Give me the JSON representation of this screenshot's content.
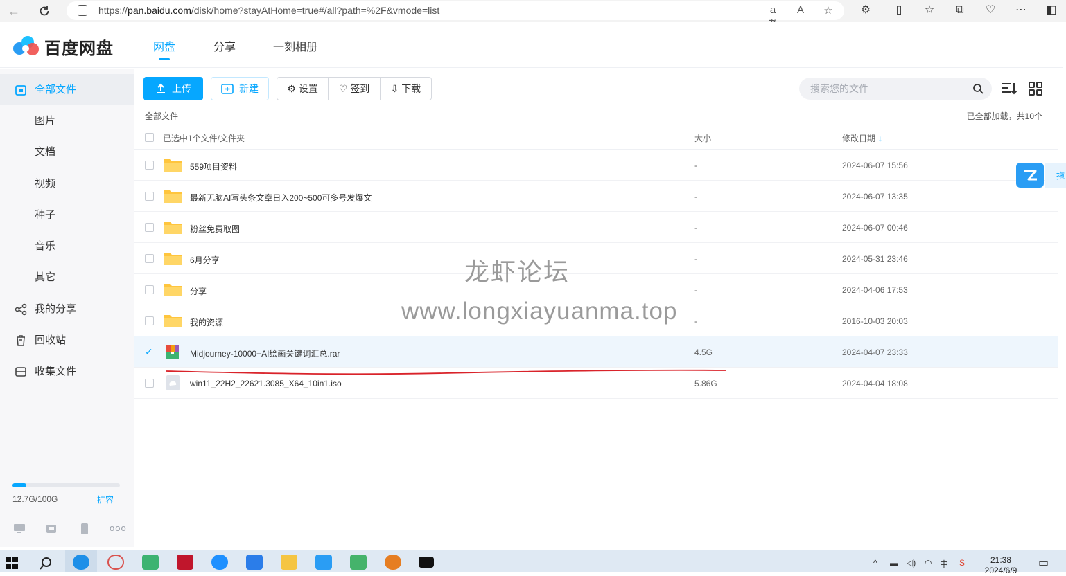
{
  "browser": {
    "url_prefix": "https://",
    "url_host": "pan.baidu.com",
    "url_path": "/disk/home?stayAtHome=true#/all?path=%2F&vmode=list"
  },
  "header": {
    "brand": "百度网盘",
    "nav": [
      "网盘",
      "分享",
      "一刻相册"
    ]
  },
  "sidebar": {
    "items": [
      {
        "label": "全部文件",
        "icon": "folder-files-icon"
      },
      {
        "label": "图片"
      },
      {
        "label": "文档"
      },
      {
        "label": "视频"
      },
      {
        "label": "种子"
      },
      {
        "label": "音乐"
      },
      {
        "label": "其它"
      },
      {
        "label": "我的分享",
        "icon": "share-icon"
      },
      {
        "label": "回收站",
        "icon": "trash-icon"
      },
      {
        "label": "收集文件",
        "icon": "inbox-icon"
      }
    ],
    "quota_used": "12.7G/100G",
    "quota_fraction": 0.127,
    "quota_expand": "扩容"
  },
  "toolbar": {
    "upload": "上传",
    "new": "新建",
    "settings": "设置",
    "checkin": "签到",
    "download": "下载",
    "search_placeholder": "搜索您的文件"
  },
  "breadcrumb": "全部文件",
  "loaded_info": "已全部加载，共10个",
  "table": {
    "header_selected": "已选中1个文件/文件夹",
    "col_size": "大小",
    "col_date": "修改日期",
    "sort_arrow": "↓",
    "rows": [
      {
        "name": "559项目资料",
        "size": "-",
        "date": "2024-06-07 15:56",
        "type": "folder"
      },
      {
        "name": "最新无脑AI写头条文章日入200~500可多号发爆文",
        "size": "-",
        "date": "2024-06-07 13:35",
        "type": "folder"
      },
      {
        "name": "粉丝免费取图",
        "size": "-",
        "date": "2024-06-07 00:46",
        "type": "folder"
      },
      {
        "name": "6月分享",
        "size": "-",
        "date": "2024-05-31 23:46",
        "type": "folder"
      },
      {
        "name": "分享",
        "size": "-",
        "date": "2024-04-06 17:53",
        "type": "folder"
      },
      {
        "name": "我的资源",
        "size": "-",
        "date": "2016-10-03 20:03",
        "type": "folder"
      },
      {
        "name": "Midjourney-10000+AI绘画关键词汇总.rar",
        "size": "4.5G",
        "date": "2024-04-07 23:33",
        "type": "rar",
        "selected": true
      },
      {
        "name": "win11_22H2_22621.3085_X64_10in1.iso",
        "size": "5.86G",
        "date": "2024-04-04 18:08",
        "type": "iso"
      }
    ]
  },
  "watermark": {
    "line1": "龙虾论坛",
    "line2": "www.longxiayuanma.top"
  },
  "float_tab": "拖",
  "taskbar": {
    "time": "21:38",
    "date": "2024/6/9"
  },
  "colors": {
    "accent": "#06a7ff",
    "folder": "#ffc53d",
    "annotation_line": "#d9232a"
  }
}
